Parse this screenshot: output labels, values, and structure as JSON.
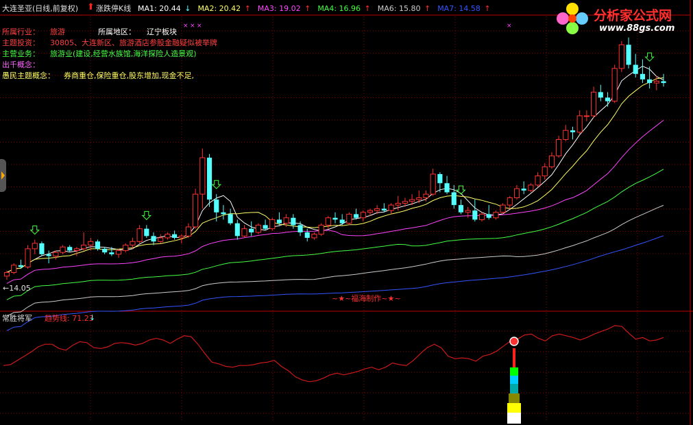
{
  "header": {
    "title": "大连圣亚(日线,前复权)",
    "indicator_name": "涨跌停K线",
    "ma": [
      {
        "label": "MA1: 20.44",
        "color": "#ffffff",
        "arrow": "↓"
      },
      {
        "label": "MA2: 20.42",
        "color": "#ffff66",
        "arrow": "↑"
      },
      {
        "label": "MA3: 19.02",
        "color": "#ff44ff",
        "arrow": "↑"
      },
      {
        "label": "MA4: 16.96",
        "color": "#44ff44",
        "arrow": "↑"
      },
      {
        "label": "MA6: 15.80",
        "color": "#cccccc",
        "arrow": "↑"
      },
      {
        "label": "MA7: 14.58",
        "color": "#3355ff",
        "arrow": "↑"
      }
    ]
  },
  "info": {
    "industry_label": "所属行业：",
    "industry_value": "旅游",
    "region_label": "所属地区：",
    "region_value": "辽宁板块",
    "theme_label": "主题投资：",
    "theme_value": "30805、大连新区、旅游酒店参股金融疑似被举牌",
    "business_label": "主营业务：",
    "business_value": "旅游业(建设,经营水族馆,海洋探险人造景观)",
    "concept_label": "出千概念：",
    "folk_label": "愚民主题概念：",
    "folk_value": "券商重仓,保险重仓,股东增加,现金不足,"
  },
  "watermark": {
    "brand": "分析家公式网",
    "url": "www.88gs.com"
  },
  "credit": "~★~福海制作~★~",
  "low_label": "←14.05",
  "sub_header": {
    "name": "常胜将军",
    "trend_label": "趋势线: 71.23",
    "trend_arrow": "↓"
  },
  "colors": {
    "up": "#ff3232",
    "down": "#54ffff",
    "trend": "#cc1a1a",
    "grid": "#8c0000"
  },
  "chart_data": [
    {
      "type": "candlestick",
      "ylim": [
        13.3,
        27.6
      ],
      "ohlc": [
        [
          14.4,
          14.7,
          14.2,
          14.6
        ],
        [
          14.6,
          15.1,
          14.5,
          15.0
        ],
        [
          15.0,
          15.3,
          14.8,
          14.9
        ],
        [
          14.9,
          16.1,
          14.8,
          15.9
        ],
        [
          15.9,
          16.4,
          15.6,
          16.2
        ],
        [
          16.2,
          16.3,
          15.5,
          15.6
        ],
        [
          15.6,
          15.8,
          15.1,
          15.5
        ],
        [
          15.5,
          15.8,
          15.3,
          15.7
        ],
        [
          15.7,
          16.1,
          15.6,
          16.0
        ],
        [
          16.0,
          16.1,
          15.7,
          15.8
        ],
        [
          15.8,
          16.0,
          15.5,
          15.9
        ],
        [
          15.9,
          16.8,
          15.8,
          16.1
        ],
        [
          16.1,
          16.5,
          15.8,
          16.3
        ],
        [
          16.3,
          16.4,
          15.8,
          15.9
        ],
        [
          15.9,
          16.0,
          15.6,
          15.7
        ],
        [
          15.7,
          16.0,
          15.5,
          15.6
        ],
        [
          15.6,
          15.9,
          15.4,
          15.8
        ],
        [
          15.8,
          16.2,
          15.7,
          16.1
        ],
        [
          16.1,
          16.5,
          15.9,
          16.3
        ],
        [
          16.3,
          17.2,
          16.2,
          17.0
        ],
        [
          17.0,
          17.2,
          16.5,
          16.6
        ],
        [
          16.6,
          16.8,
          16.1,
          16.3
        ],
        [
          16.3,
          16.7,
          16.2,
          16.5
        ],
        [
          16.5,
          16.8,
          16.4,
          16.7
        ],
        [
          16.7,
          16.9,
          16.4,
          16.5
        ],
        [
          16.5,
          16.7,
          16.2,
          16.6
        ],
        [
          16.6,
          17.3,
          16.5,
          17.1
        ],
        [
          17.1,
          19.2,
          17.0,
          18.9
        ],
        [
          18.9,
          21.4,
          18.1,
          20.9
        ],
        [
          20.9,
          21.1,
          18.2,
          18.6
        ],
        [
          18.6,
          18.9,
          17.4,
          17.9
        ],
        [
          17.9,
          18.3,
          17.5,
          17.8
        ],
        [
          17.8,
          18.1,
          17.2,
          17.3
        ],
        [
          17.3,
          17.5,
          16.4,
          16.6
        ],
        [
          16.6,
          17.2,
          16.5,
          17.0
        ],
        [
          17.0,
          17.4,
          16.6,
          16.8
        ],
        [
          16.8,
          17.3,
          16.7,
          17.2
        ],
        [
          17.2,
          17.5,
          16.9,
          17.0
        ],
        [
          17.0,
          17.6,
          16.9,
          17.5
        ],
        [
          17.5,
          17.9,
          17.2,
          17.3
        ],
        [
          17.3,
          17.8,
          17.1,
          17.6
        ],
        [
          17.6,
          17.8,
          17.0,
          17.2
        ],
        [
          17.2,
          17.4,
          16.6,
          16.8
        ],
        [
          16.8,
          17.0,
          16.3,
          16.5
        ],
        [
          16.5,
          16.8,
          16.4,
          16.7
        ],
        [
          16.7,
          17.3,
          16.6,
          17.2
        ],
        [
          17.2,
          17.7,
          17.0,
          17.6
        ],
        [
          17.6,
          17.9,
          17.3,
          17.5
        ],
        [
          17.5,
          17.8,
          17.2,
          17.3
        ],
        [
          17.3,
          17.9,
          17.2,
          17.8
        ],
        [
          17.8,
          18.1,
          17.5,
          17.6
        ],
        [
          17.6,
          18.0,
          17.4,
          17.9
        ],
        [
          17.9,
          18.1,
          17.7,
          18.0
        ],
        [
          18.0,
          18.3,
          17.8,
          18.1
        ],
        [
          18.1,
          18.4,
          17.9,
          18.0
        ],
        [
          18.0,
          18.4,
          17.8,
          18.3
        ],
        [
          18.3,
          18.8,
          18.0,
          18.4
        ],
        [
          18.4,
          18.7,
          18.2,
          18.5
        ],
        [
          18.5,
          18.9,
          18.3,
          18.6
        ],
        [
          18.6,
          19.1,
          18.4,
          18.7
        ],
        [
          18.7,
          19.1,
          18.5,
          18.9
        ],
        [
          18.9,
          20.3,
          18.8,
          20.0
        ],
        [
          20.0,
          20.1,
          19.0,
          19.5
        ],
        [
          19.5,
          19.9,
          18.9,
          19.0
        ],
        [
          19.0,
          19.4,
          18.1,
          18.3
        ],
        [
          18.3,
          18.6,
          17.8,
          17.9
        ],
        [
          17.9,
          18.2,
          17.6,
          18.0
        ],
        [
          18.0,
          18.6,
          17.4,
          17.5
        ],
        [
          17.5,
          17.9,
          17.4,
          17.8
        ],
        [
          17.8,
          18.3,
          17.5,
          17.6
        ],
        [
          17.6,
          18.0,
          17.5,
          17.9
        ],
        [
          17.9,
          18.4,
          17.8,
          18.3
        ],
        [
          18.3,
          18.8,
          18.1,
          18.7
        ],
        [
          18.7,
          19.4,
          18.6,
          19.2
        ],
        [
          19.2,
          19.6,
          18.9,
          19.1
        ],
        [
          19.1,
          19.5,
          19.0,
          19.4
        ],
        [
          19.4,
          20.1,
          19.3,
          19.9
        ],
        [
          19.9,
          20.6,
          19.7,
          20.4
        ],
        [
          20.4,
          21.2,
          20.3,
          21.0
        ],
        [
          21.0,
          22.1,
          20.9,
          21.9
        ],
        [
          21.9,
          22.7,
          21.8,
          22.4
        ],
        [
          22.4,
          22.6,
          21.9,
          22.3
        ],
        [
          22.3,
          23.5,
          22.2,
          23.2
        ],
        [
          23.2,
          23.5,
          22.9,
          23.2
        ],
        [
          23.2,
          24.8,
          23.1,
          24.5
        ],
        [
          24.5,
          24.9,
          24.0,
          24.2
        ],
        [
          24.2,
          24.5,
          23.7,
          24.0
        ],
        [
          24.0,
          26.0,
          23.9,
          25.8
        ],
        [
          25.8,
          27.3,
          25.6,
          27.1
        ],
        [
          27.1,
          27.5,
          25.8,
          26.0
        ],
        [
          26.0,
          26.6,
          25.3,
          25.5
        ],
        [
          25.5,
          26.3,
          25.0,
          25.2
        ],
        [
          25.2,
          25.9,
          24.7,
          25.0
        ],
        [
          25.0,
          25.4,
          24.6,
          25.1
        ],
        [
          25.1,
          25.5,
          24.8,
          25.0
        ]
      ],
      "ma_lines": [
        {
          "name": "MA1",
          "color": "#ffffff"
        },
        {
          "name": "MA2",
          "color": "#ffff66"
        },
        {
          "name": "MA3",
          "color": "#ff44ff"
        },
        {
          "name": "MA4",
          "color": "#44ff44"
        },
        {
          "name": "MA6",
          "color": "#cccccc"
        },
        {
          "name": "MA7",
          "color": "#3355ff"
        }
      ],
      "arrows": [
        4,
        20,
        30,
        65,
        92
      ]
    },
    {
      "type": "line",
      "ylim": [
        0,
        100
      ],
      "values": [
        49,
        50,
        55,
        60,
        65,
        71,
        74,
        74,
        69,
        67,
        73,
        77,
        76,
        70,
        69,
        71,
        75,
        76,
        75,
        73,
        75,
        79,
        81,
        79,
        75,
        80,
        84,
        83,
        74,
        63,
        53,
        51,
        48,
        47,
        49,
        49,
        50,
        52,
        53,
        55,
        48,
        43,
        36,
        32,
        30,
        31,
        34,
        38,
        40,
        38,
        40,
        42,
        45,
        47,
        44,
        47,
        52,
        50,
        49,
        55,
        63,
        70,
        74,
        70,
        60,
        57,
        58,
        57,
        54,
        60,
        62,
        66,
        72,
        78,
        80,
        85,
        86,
        81,
        78,
        84,
        86,
        84,
        82,
        79,
        82,
        86,
        89,
        92,
        96,
        95,
        87,
        80,
        82,
        78,
        79,
        82
      ]
    }
  ]
}
